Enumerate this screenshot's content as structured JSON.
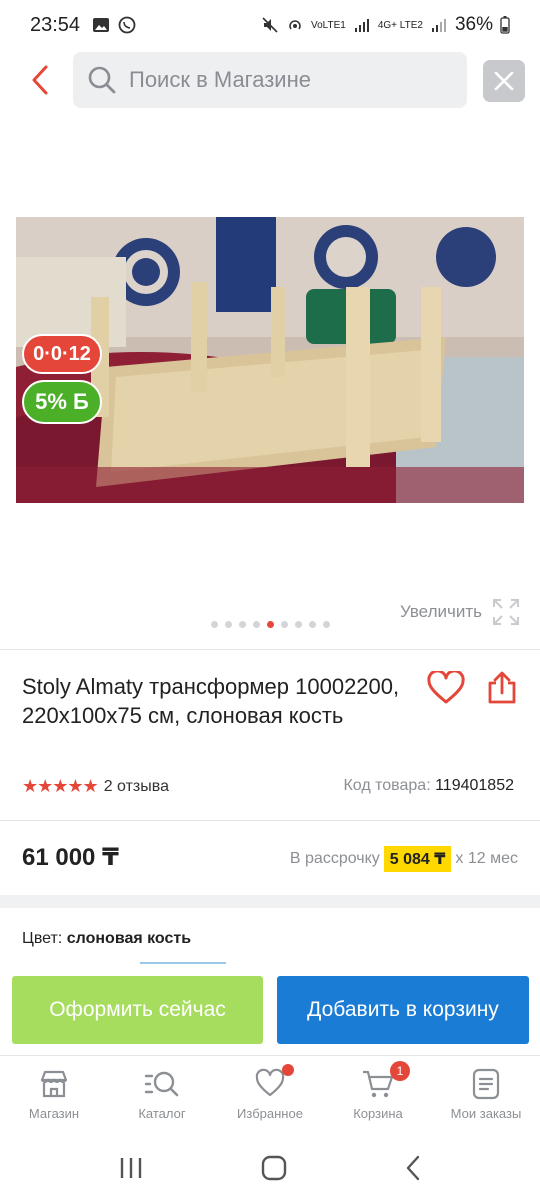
{
  "status_bar": {
    "time": "23:54",
    "network1": "VoLTE1",
    "network2": "4G+ LTE2",
    "battery": "36%"
  },
  "search": {
    "placeholder": "Поиск в Магазине"
  },
  "gallery": {
    "timer_badge": "0·0·12",
    "bonus_badge": "5% Б",
    "zoom_label": "Увеличить",
    "dots_total": 9,
    "active_dot": 4
  },
  "product": {
    "title": "Stoly Almaty трансформер 10002200, 220x100x75 см, слоновая кость",
    "stars": "★★★★★",
    "reviews": "2 отзыва",
    "sku_label": "Код товара:",
    "sku_value": "119401852",
    "price": "61 000 ₸",
    "installment_prefix": "В рассрочку",
    "installment_amount": "5 084 ₸",
    "installment_suffix": "x 12 мес",
    "color_label": "Цвет:",
    "color_value": "слоновая кость"
  },
  "actions": {
    "buy_now": "Оформить сейчас",
    "add_to_cart": "Добавить в корзину"
  },
  "bottom_nav": {
    "items": [
      {
        "label": "Магазин",
        "icon": "shop-icon"
      },
      {
        "label": "Каталог",
        "icon": "catalog-icon"
      },
      {
        "label": "Избранное",
        "icon": "heart-icon"
      },
      {
        "label": "Корзина",
        "icon": "cart-icon",
        "badge": "1"
      },
      {
        "label": "Мои заказы",
        "icon": "orders-icon"
      }
    ]
  },
  "colors": {
    "accent_red": "#e4473a",
    "bonus_green": "#4caf28",
    "buy_green": "#a7dd5f",
    "cart_blue": "#1b7cd6",
    "installment_yellow": "#ffd800"
  }
}
